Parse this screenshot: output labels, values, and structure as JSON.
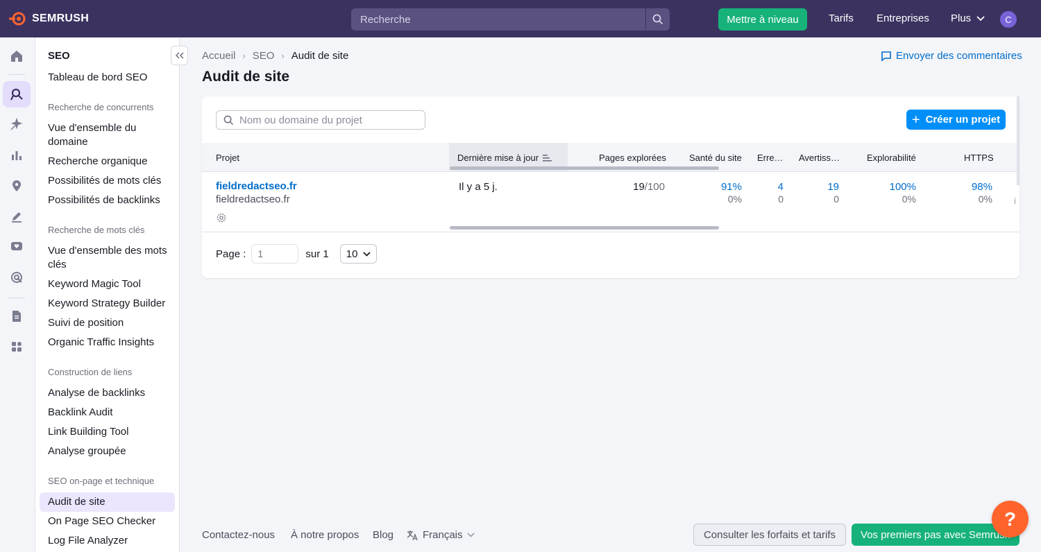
{
  "topbar": {
    "brand": "SEMRUSH",
    "search_placeholder": "Recherche",
    "upgrade": "Mettre à niveau",
    "nav": [
      "Tarifs",
      "Entreprises",
      "Plus"
    ],
    "avatar": "C"
  },
  "sidebar": {
    "title": "SEO",
    "dashboard": "Tableau de bord SEO",
    "sections": [
      {
        "title": "Recherche de concurrents",
        "items": [
          "Vue d'ensemble du domaine",
          "Recherche organique",
          "Possibilités de mots clés",
          "Possibilités de backlinks"
        ]
      },
      {
        "title": "Recherche de mots clés",
        "items": [
          "Vue d'ensemble des mots clés",
          "Keyword Magic Tool",
          "Keyword Strategy Builder",
          "Suivi de position",
          "Organic Traffic Insights"
        ]
      },
      {
        "title": "Construction de liens",
        "items": [
          "Analyse de backlinks",
          "Backlink Audit",
          "Link Building Tool",
          "Analyse groupée"
        ]
      },
      {
        "title": "SEO on-page et technique",
        "items": [
          "Audit de site",
          "On Page SEO Checker",
          "Log File Analyzer"
        ]
      }
    ]
  },
  "breadcrumb": [
    "Accueil",
    "SEO",
    "Audit de site"
  ],
  "page_title": "Audit de site",
  "feedback": "Envoyer des commentaires",
  "projects": {
    "search_placeholder": "Nom ou domaine du projet",
    "create_button": "Créer un projet",
    "columns": [
      "Projet",
      "Dernière mise à jour",
      "Pages explorées",
      "Santé du site",
      "Erre…",
      "Avertiss…",
      "Explorabilité",
      "HTTPS"
    ],
    "row": {
      "name": "fieldredactseo.fr",
      "domain": "fieldredactseo.fr",
      "updated": "Il y a 5 j.",
      "pages_crawled": "19",
      "pages_limit": "/100",
      "health": "91%",
      "health_change": "0%",
      "errors": "4",
      "errors_change": "0",
      "warnings": "19",
      "warnings_change": "0",
      "crawlability": "100%",
      "crawlability_change": "0%",
      "https": "98%",
      "https_change": "0%",
      "overflow_glyph": "i"
    }
  },
  "pagination": {
    "label": "Page :",
    "value": "1",
    "of": "sur 1",
    "per_page": "10"
  },
  "footer": {
    "links": [
      "Contactez-nous",
      "À notre propos",
      "Blog",
      "Français"
    ],
    "plans_button": "Consulter les forfaits et tarifs",
    "start_button": "Vos premiers pas avec Semrush",
    "help": "?"
  },
  "colors": {
    "topbar": "#3b3260",
    "accent_green": "#16b27a",
    "link_blue": "#006dca",
    "primary_blue": "#008ff8",
    "help_orange": "#ff642d"
  }
}
